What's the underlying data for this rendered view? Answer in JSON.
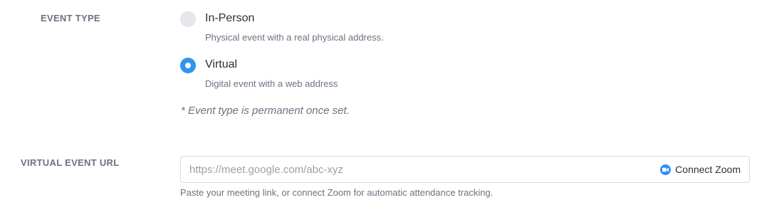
{
  "event_type": {
    "label": "EVENT TYPE",
    "options": [
      {
        "title": "In-Person",
        "description": "Physical event with a real physical address.",
        "selected": false
      },
      {
        "title": "Virtual",
        "description": "Digital event with a web address",
        "selected": true
      }
    ],
    "note": "* Event type is permanent once set."
  },
  "virtual_url": {
    "label": "VIRTUAL EVENT URL",
    "placeholder": "https://meet.google.com/abc-xyz",
    "value": "",
    "connect_label": "Connect Zoom",
    "connect_icon": "zoom-camera-icon",
    "helper": "Paste your meeting link, or connect Zoom for automatic attendance tracking."
  },
  "colors": {
    "accent": "#2d95f0",
    "zoom": "#2d8cff",
    "muted_text": "#6b7280"
  }
}
